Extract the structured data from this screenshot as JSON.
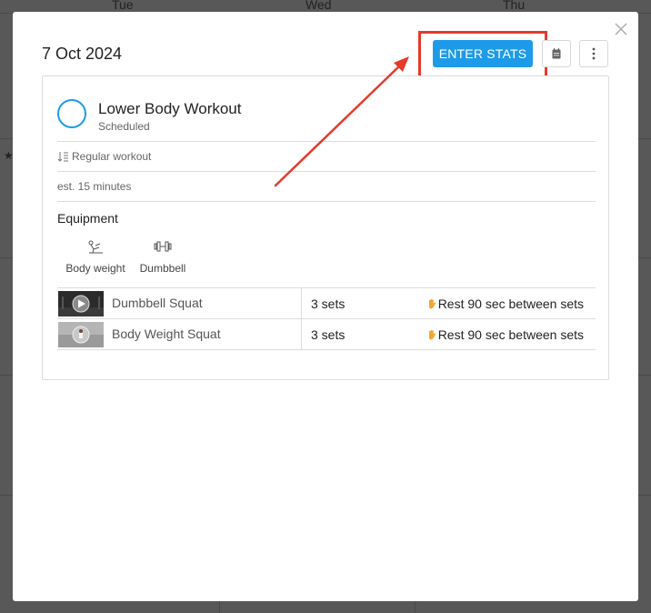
{
  "calendar": {
    "days": [
      "Tue",
      "Wed",
      "Thu"
    ]
  },
  "modal": {
    "date": "7 Oct 2024",
    "enter_stats_label": "ENTER STATS",
    "workout": {
      "name": "Lower Body Workout",
      "status": "Scheduled",
      "type": "Regular workout",
      "duration": "est. 15 minutes",
      "equipment_title": "Equipment",
      "equipment": [
        {
          "label": "Body weight",
          "icon": "bodyweight-icon"
        },
        {
          "label": "Dumbbell",
          "icon": "dumbbell-icon"
        }
      ],
      "exercises": [
        {
          "name": "Dumbbell Squat",
          "sets": "3 sets",
          "rest": "Rest 90 sec between sets"
        },
        {
          "name": "Body Weight Squat",
          "sets": "3 sets",
          "rest": "Rest 90 sec between sets"
        }
      ]
    }
  },
  "colors": {
    "accent": "#1e9be8",
    "highlight": "#e53a2c",
    "overlay": "#585858"
  }
}
